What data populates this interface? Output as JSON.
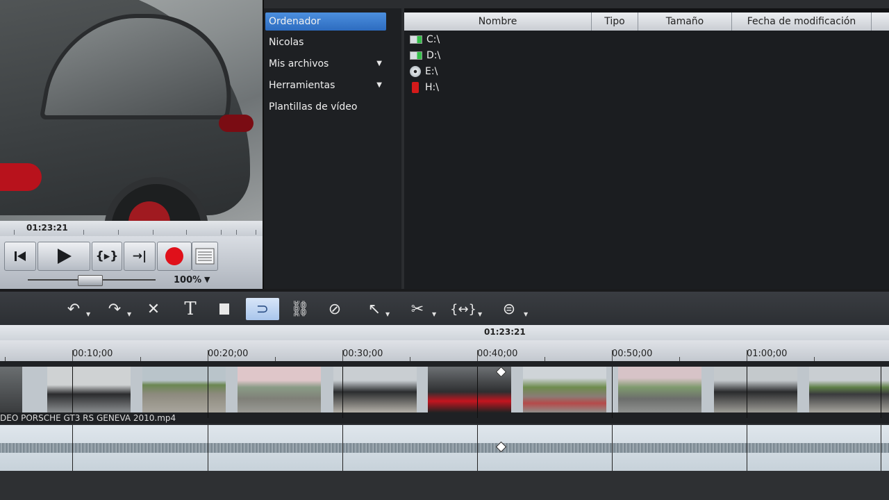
{
  "preview": {
    "timecode": "01:23:21",
    "zoom": "100%"
  },
  "transport": {
    "prev_icon": "skip-back-icon",
    "play_icon": "play-icon",
    "range_icon": "play-range-icon",
    "next_icon": "skip-to-end-icon",
    "record_icon": "record-icon",
    "list_icon": "list-icon"
  },
  "nav": {
    "items": [
      {
        "label": "Ordenador",
        "active": true
      },
      {
        "label": "Nicolas"
      },
      {
        "label": "Mis archivos",
        "has_arrow": true
      },
      {
        "label": "Herramientas",
        "has_arrow": true
      },
      {
        "label": "Plantillas de vídeo"
      }
    ]
  },
  "files": {
    "columns": [
      "Nombre",
      "Tipo",
      "Tamaño",
      "Fecha de modificación"
    ],
    "drives": [
      {
        "label": "C:\\",
        "icon": "hard-drive-icon"
      },
      {
        "label": "D:\\",
        "icon": "hard-drive-icon"
      },
      {
        "label": "E:\\",
        "icon": "optical-disc-icon"
      },
      {
        "label": "H:\\",
        "icon": "usb-drive-icon"
      }
    ]
  },
  "toolbar": {
    "tools": [
      "undo-icon",
      "redo-icon",
      "delete-icon",
      "title-icon",
      "marker-icon",
      "loop-icon",
      "link-icon",
      "unlink-icon",
      "cursor-mode-icon",
      "cut-icon",
      "range-icon",
      "effects-icon"
    ]
  },
  "timeline": {
    "position": "01:23:21",
    "ruler_labels": [
      "00:10;00",
      "00:20;00",
      "00:30;00",
      "00:40;00",
      "00:50;00",
      "01:00;00"
    ],
    "clip_name": "DEO PORSCHE GT3 RS GENEVA 2010.mp4"
  },
  "colors": {
    "accent": "#3a7fd5",
    "record": "#e0101a"
  }
}
